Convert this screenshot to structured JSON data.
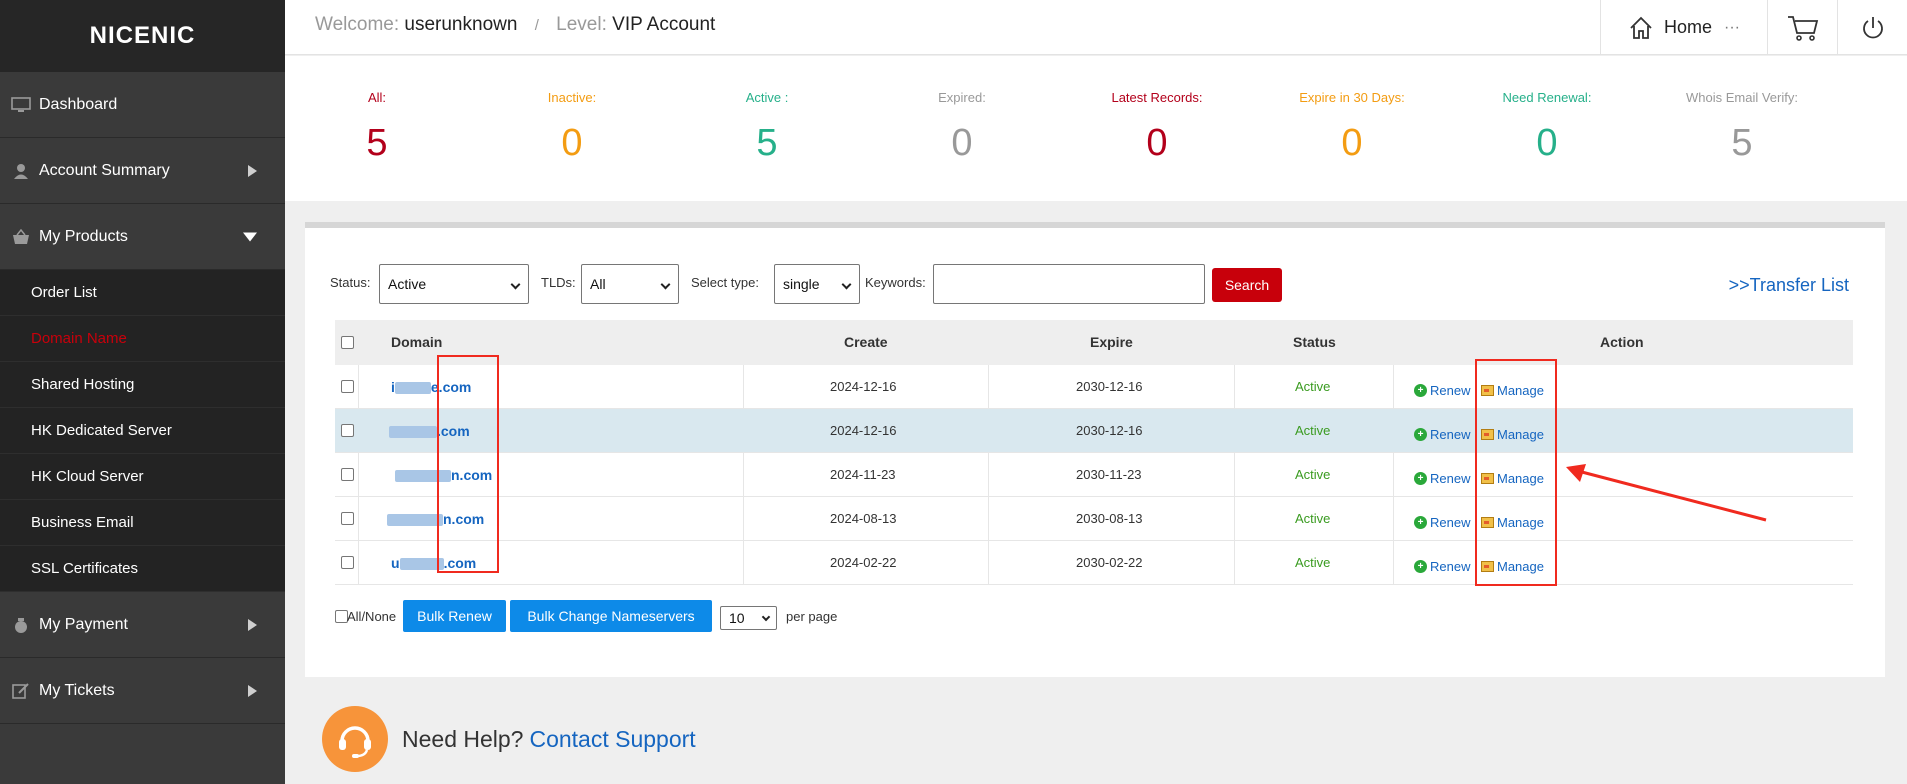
{
  "brand": {
    "logo": "NICENIC"
  },
  "sidebar": {
    "items": [
      {
        "label": "Dashboard"
      },
      {
        "label": "Account Summary"
      },
      {
        "label": "My Products"
      },
      {
        "label": "My Payment"
      },
      {
        "label": "My Tickets"
      }
    ],
    "products_sub": [
      {
        "label": "Order List"
      },
      {
        "label": "Domain Name"
      },
      {
        "label": "Shared Hosting"
      },
      {
        "label": "HK Dedicated Server"
      },
      {
        "label": "HK Cloud Server"
      },
      {
        "label": "Business Email"
      },
      {
        "label": "SSL Certificates"
      }
    ]
  },
  "header": {
    "welcome_label": "Welcome:",
    "username": "userunknown",
    "separator": "/",
    "level_label": "Level:",
    "level_value": "VIP Account",
    "home_label": "Home",
    "more_glyph": "···"
  },
  "stats": [
    {
      "label": "All:",
      "value": "5",
      "color": "#b3001b"
    },
    {
      "label": "Inactive:",
      "value": "0",
      "color": "#f39c12"
    },
    {
      "label": "Active :",
      "value": "5",
      "color": "#26b08a"
    },
    {
      "label": "Expired:",
      "value": "0",
      "color": "#999999"
    },
    {
      "label": "Latest Records:",
      "value": "0",
      "color": "#b3001b"
    },
    {
      "label": "Expire in 30 Days:",
      "value": "0",
      "color": "#f39c12"
    },
    {
      "label": "Need Renewal:",
      "value": "0",
      "color": "#26b08a"
    },
    {
      "label": "Whois Email Verify:",
      "value": "5",
      "color": "#999999"
    }
  ],
  "filters": {
    "status_label": "Status:",
    "status_value": "Active",
    "tlds_label": "TLDs:",
    "tlds_value": "All",
    "type_label": "Select type:",
    "type_value": "single",
    "keywords_label": "Keywords:",
    "search_label": "Search",
    "transfer_link": ">>Transfer List"
  },
  "table": {
    "headers": {
      "domain": "Domain",
      "create": "Create",
      "expire": "Expire",
      "status": "Status",
      "action": "Action"
    },
    "rows": [
      {
        "domain_prefix": "i",
        "domain_suffix": "e.com",
        "create": "2024-12-16",
        "expire": "2030-12-16",
        "status": "Active",
        "renew": "Renew",
        "manage": "Manage"
      },
      {
        "domain_prefix": "",
        "domain_suffix": ".com",
        "create": "2024-12-16",
        "expire": "2030-12-16",
        "status": "Active",
        "renew": "Renew",
        "manage": "Manage"
      },
      {
        "domain_prefix": "",
        "domain_suffix": "n.com",
        "create": "2024-11-23",
        "expire": "2030-11-23",
        "status": "Active",
        "renew": "Renew",
        "manage": "Manage"
      },
      {
        "domain_prefix": "",
        "domain_suffix": "n.com",
        "create": "2024-08-13",
        "expire": "2030-08-13",
        "status": "Active",
        "renew": "Renew",
        "manage": "Manage"
      },
      {
        "domain_prefix": "u",
        "domain_suffix": ".com",
        "create": "2024-02-22",
        "expire": "2030-02-22",
        "status": "Active",
        "renew": "Renew",
        "manage": "Manage"
      }
    ]
  },
  "bulk": {
    "all_none": "All/None",
    "bulk_renew": "Bulk Renew",
    "bulk_ns": "Bulk Change Nameservers",
    "per_page_value": "10",
    "per_page_label": "per page"
  },
  "help": {
    "text": "Need Help?",
    "link": "Contact Support"
  },
  "colors": {
    "accent_red": "#c8000b",
    "link_blue": "#1565c0",
    "button_blue": "#0d8ae8",
    "annotation_red": "#f02a1f"
  }
}
